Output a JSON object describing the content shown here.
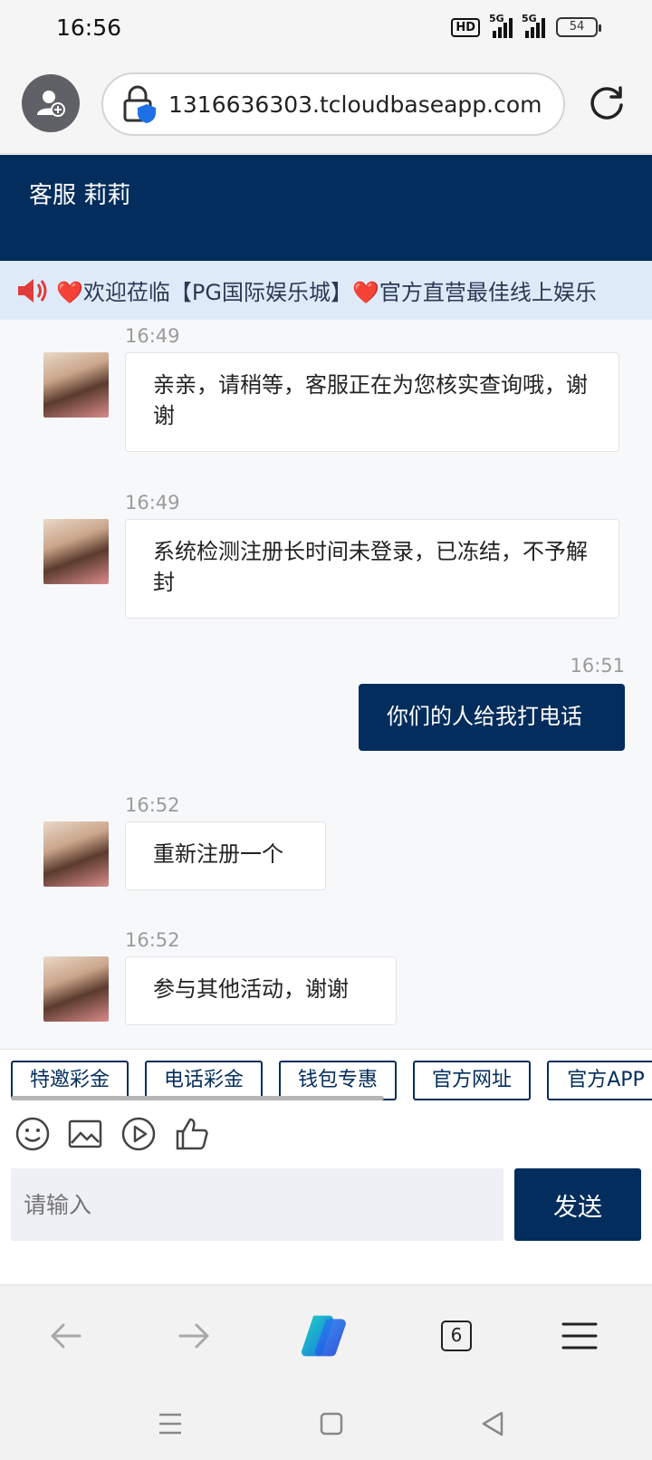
{
  "status": {
    "time": "16:56",
    "hd": "HD",
    "signal1": "5G",
    "signal2": "5G",
    "battery": "54"
  },
  "browser": {
    "url": "1316636303.tcloudbaseapp.com",
    "tab_count": "6"
  },
  "chat": {
    "title": "客服 莉莉",
    "marquee": "❤️欢迎莅临【PG国际娱乐城】❤️官方直营最佳线上娱乐"
  },
  "messages": [
    {
      "time": "16:49",
      "text": "亲亲，请稍等，客服正在为您核实查询哦，谢谢",
      "side": "in"
    },
    {
      "time": "16:49",
      "text": "系统检测注册长时间未登录，已冻结，不予解封",
      "side": "in"
    },
    {
      "time": "16:51",
      "text": "你们的人给我打电话",
      "side": "out"
    },
    {
      "time": "16:52",
      "text": "重新注册一个",
      "side": "in"
    },
    {
      "time": "16:52",
      "text": "参与其他活动，谢谢",
      "side": "in"
    }
  ],
  "quick_buttons": [
    "特邀彩金",
    "电话彩金",
    "钱包专惠",
    "官方网址",
    "官方APP"
  ],
  "input": {
    "placeholder": "请输入",
    "send_label": "发送"
  },
  "icons": {
    "emoji": "smile-icon",
    "image": "image-icon",
    "video": "play-icon",
    "like": "thumbs-up-icon"
  }
}
